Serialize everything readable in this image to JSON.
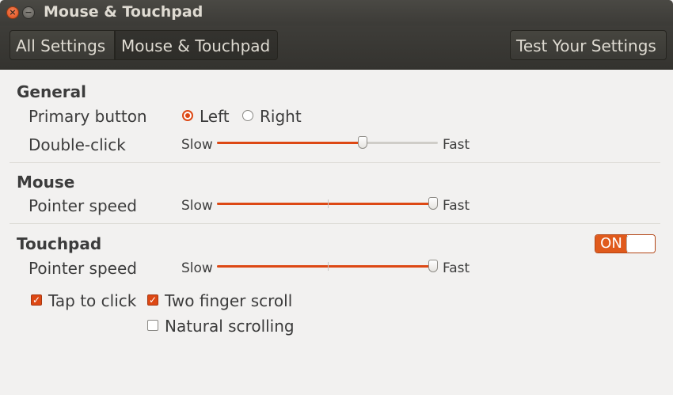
{
  "window": {
    "title": "Mouse & Touchpad",
    "close_glyph": "×",
    "min_glyph": "−"
  },
  "toolbar": {
    "all_settings": "All Settings",
    "current": "Mouse & Touchpad",
    "test": "Test Your Settings"
  },
  "general": {
    "title": "General",
    "primary_button_label": "Primary button",
    "left": "Left",
    "right": "Right",
    "selected": "Left",
    "double_click_label": "Double-click",
    "slow": "Slow",
    "fast": "Fast",
    "double_click_value": 0.66
  },
  "mouse": {
    "title": "Mouse",
    "pointer_speed_label": "Pointer speed",
    "slow": "Slow",
    "fast": "Fast",
    "pointer_speed_value": 0.98
  },
  "touchpad": {
    "title": "Touchpad",
    "switch_on": "ON",
    "enabled": true,
    "pointer_speed_label": "Pointer speed",
    "slow": "Slow",
    "fast": "Fast",
    "pointer_speed_value": 0.98,
    "tap_to_click": "Tap to click",
    "tap_to_click_checked": true,
    "two_finger_scroll": "Two finger scroll",
    "two_finger_scroll_checked": true,
    "natural_scrolling": "Natural scrolling",
    "natural_scrolling_checked": false
  },
  "colors": {
    "accent": "#dd4814",
    "titlebar": "#3c3b37",
    "background": "#f2f1f0"
  }
}
